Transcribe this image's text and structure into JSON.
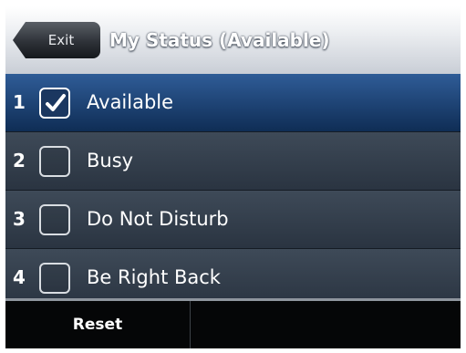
{
  "header": {
    "exit_label": "Exit",
    "title": "My Status (Available)"
  },
  "status_items": [
    {
      "number": "1",
      "label": "Available",
      "checked": true
    },
    {
      "number": "2",
      "label": "Busy",
      "checked": false
    },
    {
      "number": "3",
      "label": "Do Not Disturb",
      "checked": false
    },
    {
      "number": "4",
      "label": "Be Right Back",
      "checked": false
    }
  ],
  "softkeys": {
    "key1_label": "Reset",
    "key2_label": ""
  },
  "colors": {
    "header_background": "#dfe2e7",
    "selected_item": "#1f4578",
    "list_background": "#333e4c",
    "softkey_bar": "#050607"
  },
  "icons": {
    "checked": "check-icon"
  }
}
